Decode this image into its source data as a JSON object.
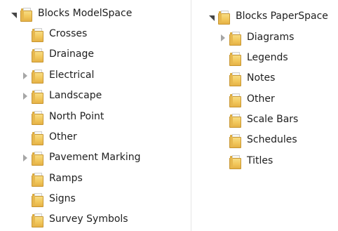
{
  "left_tree": {
    "root": {
      "label": "Blocks ModelSpace",
      "expanded": true
    },
    "children": [
      {
        "label": "Crosses",
        "expandable": false
      },
      {
        "label": "Drainage",
        "expandable": false
      },
      {
        "label": "Electrical",
        "expandable": true
      },
      {
        "label": "Landscape",
        "expandable": true
      },
      {
        "label": "North Point",
        "expandable": false
      },
      {
        "label": "Other",
        "expandable": false
      },
      {
        "label": "Pavement Marking",
        "expandable": true
      },
      {
        "label": "Ramps",
        "expandable": false
      },
      {
        "label": "Signs",
        "expandable": false
      },
      {
        "label": "Survey Symbols",
        "expandable": false
      }
    ]
  },
  "right_tree": {
    "root": {
      "label": "Blocks PaperSpace",
      "expanded": true
    },
    "children": [
      {
        "label": "Diagrams",
        "expandable": true
      },
      {
        "label": "Legends",
        "expandable": false
      },
      {
        "label": "Notes",
        "expandable": false
      },
      {
        "label": "Other",
        "expandable": false
      },
      {
        "label": "Scale Bars",
        "expandable": false
      },
      {
        "label": "Schedules",
        "expandable": false
      },
      {
        "label": "Titles",
        "expandable": false
      }
    ]
  }
}
